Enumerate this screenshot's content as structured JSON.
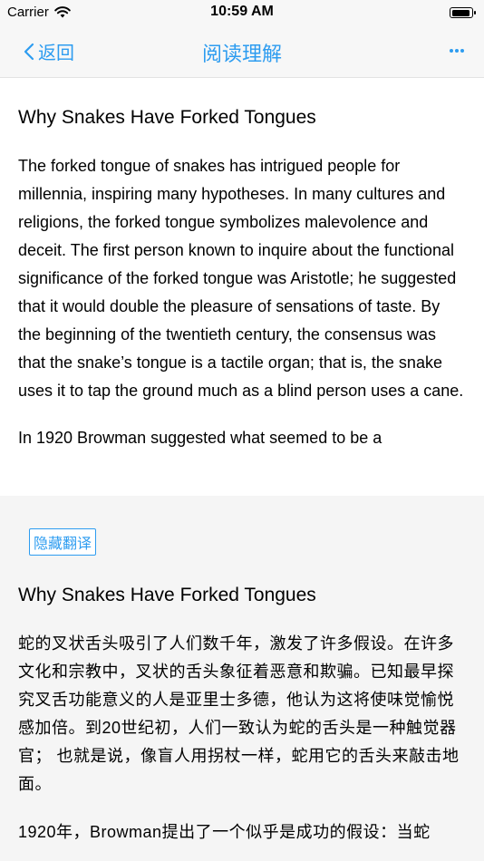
{
  "status_bar": {
    "carrier": "Carrier",
    "time": "10:59 AM"
  },
  "nav": {
    "back_label": "返回",
    "title": "阅读理解"
  },
  "article": {
    "title": "Why Snakes Have Forked Tongues",
    "paragraphs": [
      "The forked tongue of snakes has intrigued people for millennia, inspiring many hypotheses. In many cultures and religions, the forked tongue symbolizes malevolence and deceit. The first person known to inquire about the functional significance of the forked tongue was Aristotle; he suggested that it would double the pleasure of sensations of taste. By the beginning of the twentieth century, the consensus was that the snake’s tongue is a tactile organ; that is, the snake uses it to tap the ground much as a blind person uses a cane.",
      "In 1920 Browman suggested what seemed to be a"
    ]
  },
  "translation": {
    "toggle_label": "隐藏翻译",
    "title": "Why Snakes Have Forked Tongues",
    "paragraphs": [
      "蛇的叉状舌头吸引了人们数千年，激发了许多假设。在许多文化和宗教中，叉状的舌头象征着恶意和欺骗。已知最早探究叉舌功能意义的人是亚里士多德，他认为这将使味觉愉悦感加倍。到20世纪初，人们一致认为蛇的舌头是一种触觉器官； 也就是说，像盲人用拐杖一样，蛇用它的舌头来敲击地面。",
      "1920年，Browman提出了一个似乎是成功的假设：当蛇"
    ]
  },
  "colors": {
    "accent": "#2d9cf0",
    "nav_background": "#f7f7f7",
    "translation_background": "#f5f5f5"
  }
}
